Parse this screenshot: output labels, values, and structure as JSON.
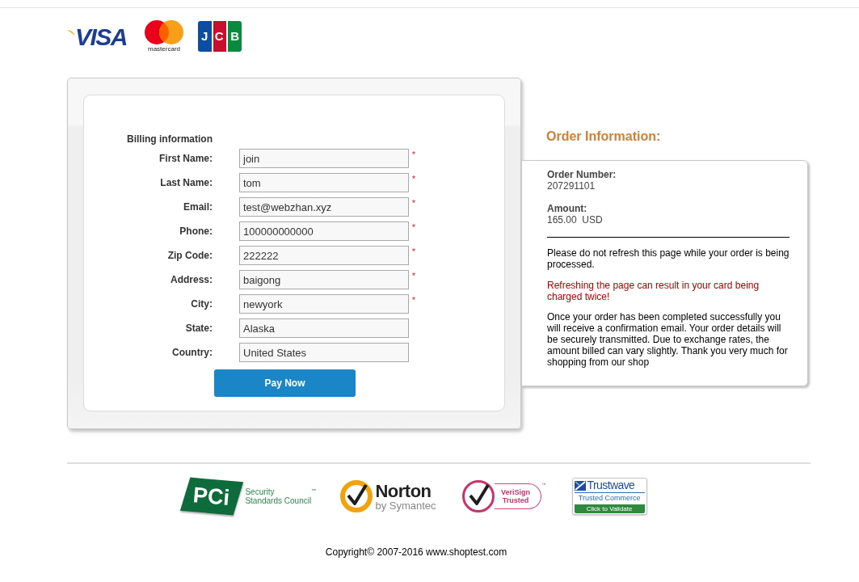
{
  "card_logos": [
    {
      "kind": "visa",
      "text": "VISA"
    },
    {
      "kind": "mastercard",
      "text": "mastercard"
    },
    {
      "kind": "jcb",
      "text": "JCB"
    }
  ],
  "billing": {
    "title": "Billing information",
    "required_mark": "*",
    "fields": [
      {
        "label": "First Name:",
        "value": "join",
        "required": true
      },
      {
        "label": "Last Name:",
        "value": "tom",
        "required": true
      },
      {
        "label": "Email:",
        "value": "test@webzhan.xyz",
        "required": true
      },
      {
        "label": "Phone:",
        "value": "100000000000",
        "required": true
      },
      {
        "label": "Zip Code:",
        "value": "222222",
        "required": true
      },
      {
        "label": "Address:",
        "value": "baigong",
        "required": true
      },
      {
        "label": "City:",
        "value": "newyork",
        "required": true
      },
      {
        "label": "State:",
        "value": "Alaska",
        "required": false
      },
      {
        "label": "Country:",
        "value": "United States",
        "required": false
      }
    ],
    "submit": "Pay Now"
  },
  "order": {
    "title": "Order Information:",
    "number_label": "Order Number:",
    "number": "207291101",
    "amount_label": "Amount:",
    "amount": "165.00  USD",
    "notice": "Please do not refresh this page while your order is being processed.",
    "warning": "Refreshing the page can result in your card being charged twice!",
    "info": "Once your order has been completed successfully you will receive a confirmation email. Your order details will be securely transmitted. Due to exchange rates, the amount billed can vary slightly. Thank you very much for shopping from our shop"
  },
  "trust_badges": [
    {
      "kind": "pci",
      "mark": "PCi",
      "lines": [
        "Security",
        "Standards Council"
      ],
      "tm": "™"
    },
    {
      "kind": "norton",
      "name": "Norton",
      "byline": "by Symantec"
    },
    {
      "kind": "verisign",
      "lines": [
        "VeriSign",
        "Trusted"
      ],
      "tm": "™"
    },
    {
      "kind": "trustwave",
      "name": "Trustwave",
      "tagline": "Trusted Commerce",
      "action": "Click to Validate"
    }
  ],
  "copyright": "Copyright© 2007-2016 www.shoptest.com"
}
